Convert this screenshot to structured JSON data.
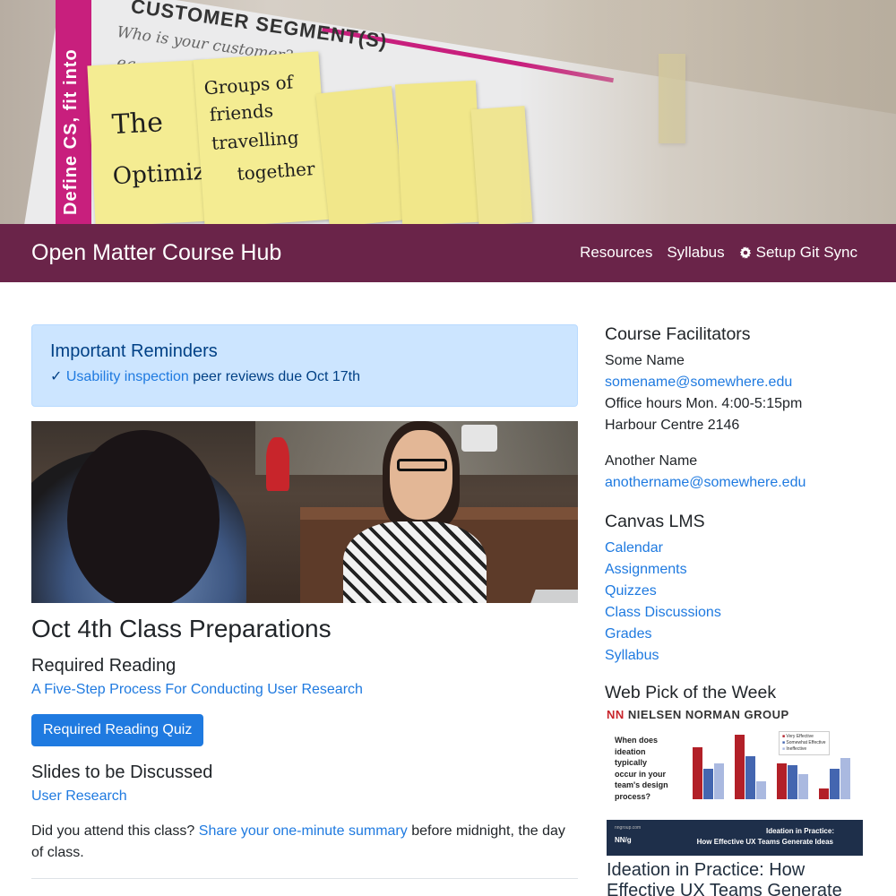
{
  "hero": {
    "board_headline": "CUSTOMER SEGMENT(S)",
    "board_sub1": "Who is your customer?",
    "board_sub2": "eg. working par",
    "side_stripe": "Define CS, fit into",
    "notes": [
      "The",
      "Optimizer",
      "Groups of",
      "friends",
      "travelling",
      "together"
    ]
  },
  "navbar": {
    "brand": "Open Matter Course Hub",
    "links": [
      "Resources",
      "Syllabus"
    ],
    "setup": "Setup Git Sync"
  },
  "reminders": {
    "title": "Important Reminders",
    "check": "✓",
    "link": "Usability inspection",
    "text": " peer reviews due Oct 17th"
  },
  "prep": {
    "title": "Oct 4th Class Preparations",
    "reading_heading": "Required Reading",
    "reading_link": "A Five-Step Process For Conducting User Research",
    "quiz_button": "Required Reading Quiz",
    "slides_heading": "Slides to be Discussed",
    "slides_link": "User Research",
    "attend_prefix": "Did you attend this class? ",
    "attend_link": "Share your one-minute summary",
    "attend_suffix": " before midnight, the day of class."
  },
  "sidebar": {
    "facilitators_heading": "Course Facilitators",
    "facilitator1": {
      "name": "Some Name",
      "email": "somename@somewhere.edu",
      "hours": "Office hours Mon. 4:00-5:15pm",
      "room": "Harbour Centre 2146"
    },
    "facilitator2": {
      "name": "Another Name",
      "email": "anothername@somewhere.edu"
    },
    "lms_heading": "Canvas LMS",
    "lms_links": [
      "Calendar",
      "Assignments",
      "Quizzes",
      "Class Discussions",
      "Grades",
      "Syllabus"
    ],
    "webpick_heading": "Web Pick of the Week",
    "webpick": {
      "brand_mark": "NN",
      "brand": "NIELSEN NORMAN GROUP",
      "question": "When does ideation typically occur in your team's design process?",
      "legend": [
        "Very Effective",
        "Somewhat Effective",
        "Ineffective"
      ],
      "footer_site": "nngroup.com",
      "footer_logo": "NN/g",
      "footer_title1": "Ideation in Practice:",
      "footer_title2": "How Effective UX Teams Generate Ideas",
      "title": "Ideation in Practice: How Effective UX Teams Generate"
    }
  },
  "colors": {
    "navbar": "#6a2449",
    "link": "#1f7ae0",
    "alert_bg": "#cce5ff",
    "alert_text": "#004085",
    "bar_red": "#b22028",
    "bar_blue": "#4466b0",
    "bar_light": "#aab9e0"
  }
}
